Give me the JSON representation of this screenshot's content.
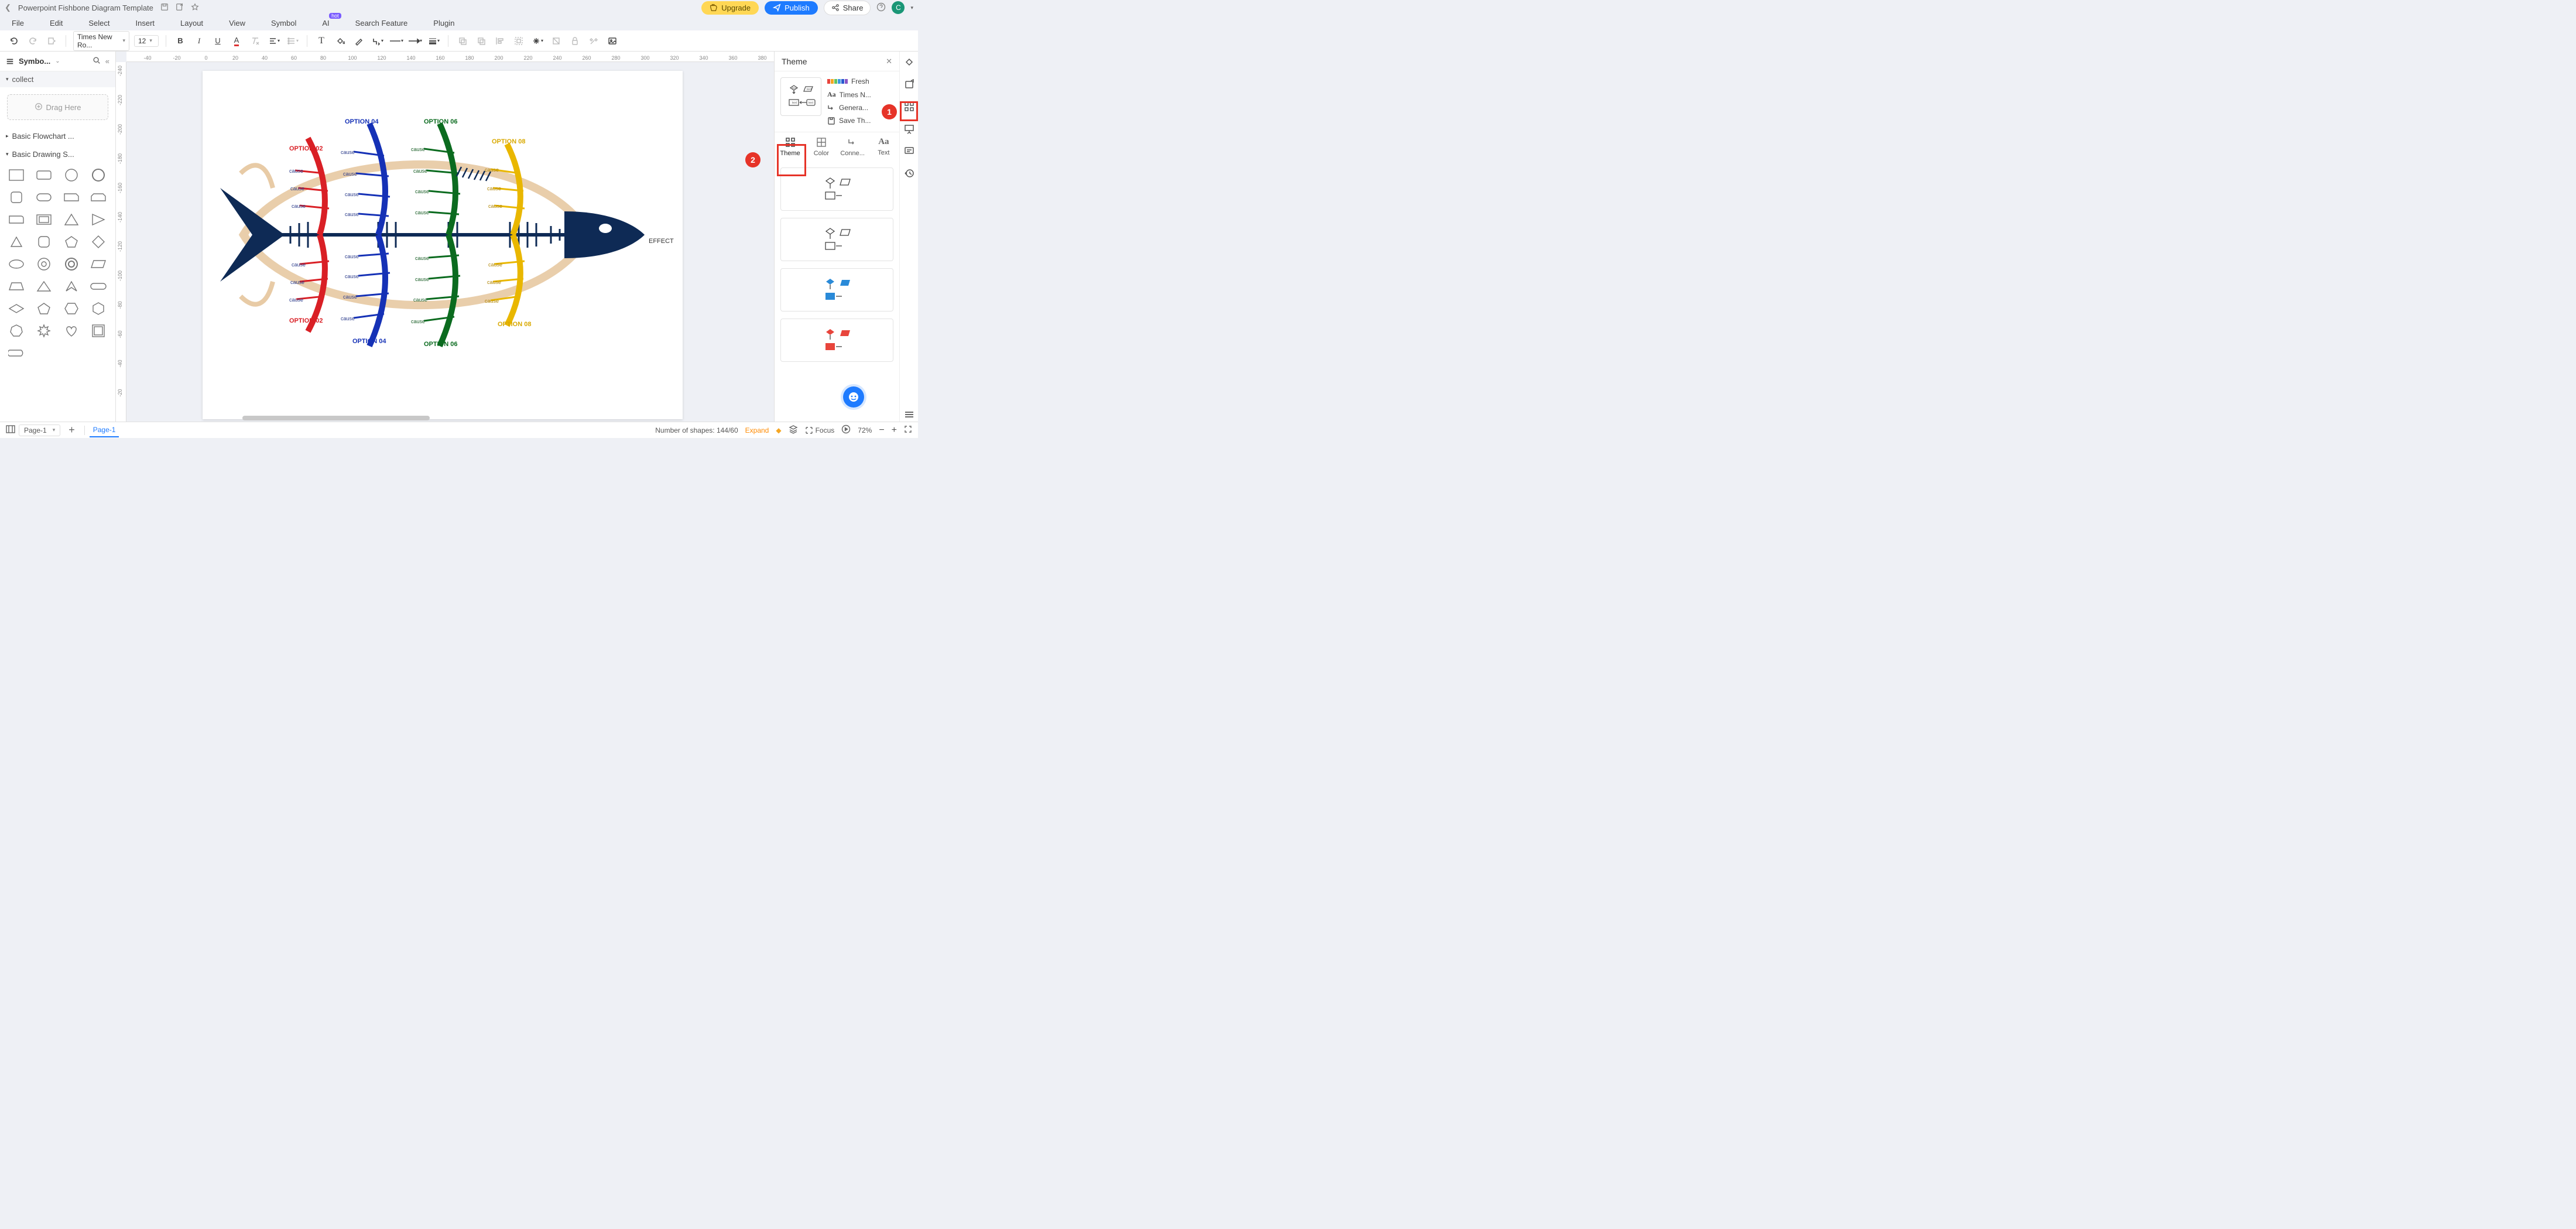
{
  "titlebar": {
    "title": "Powerpoint Fishbone Diagram Template"
  },
  "buttons": {
    "upgrade": "Upgrade",
    "publish": "Publish",
    "share": "Share"
  },
  "avatar": "C",
  "menu": [
    "File",
    "Edit",
    "Select",
    "Insert",
    "Layout",
    "View",
    "Symbol",
    "AI",
    "Search Feature",
    "Plugin"
  ],
  "ai_badge": "hot",
  "toolbar": {
    "font": "Times New Ro...",
    "size": "12"
  },
  "left": {
    "title": "Symbo...",
    "collect": "collect",
    "drag": "Drag Here",
    "cat1": "Basic Flowchart ...",
    "cat2": "Basic Drawing S..."
  },
  "ruler_h": [
    "-40",
    "-20",
    "0",
    "20",
    "40",
    "60",
    "80",
    "100",
    "120",
    "140",
    "160",
    "180",
    "200",
    "220",
    "240",
    "260",
    "280",
    "300",
    "320",
    "340",
    "360",
    "380"
  ],
  "ruler_v": [
    "-240",
    "-220",
    "-200",
    "-180",
    "-160",
    "-140",
    "-120",
    "-100",
    "-80",
    "-60",
    "-40",
    "-20"
  ],
  "diagram": {
    "effect": "EFFECT",
    "branches": [
      {
        "top": "OPTION 02",
        "bottom": "OPTION 02",
        "color": "#d91f25"
      },
      {
        "top": "OPTION 04",
        "bottom": "OPTION 04",
        "color": "#1531b6"
      },
      {
        "top": "OPTION 06",
        "bottom": "OPTION 06",
        "color": "#0b6b1f"
      },
      {
        "top": "OPTION 08",
        "bottom": "OPTION 08",
        "color": "#e9b700"
      }
    ],
    "cause": "cause"
  },
  "theme": {
    "title": "Theme",
    "fresh": "Fresh",
    "font": "Times N...",
    "connector": "Genera...",
    "save": "Save Th...",
    "tabs": [
      "Theme",
      "Color",
      "Conne...",
      "Text"
    ]
  },
  "callouts": {
    "one": "1",
    "two": "2"
  },
  "status": {
    "page_sel": "Page-1",
    "page_tab": "Page-1",
    "shapes": "Number of shapes: 144/60",
    "expand": "Expand",
    "focus": "Focus",
    "zoom": "72%"
  }
}
